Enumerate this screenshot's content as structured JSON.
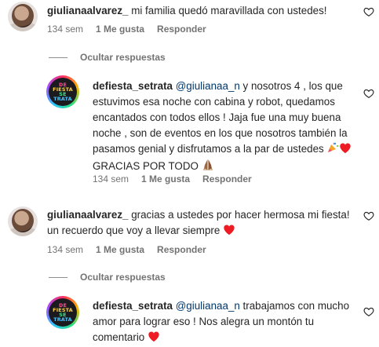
{
  "comments": [
    {
      "username": "giulianaalvarez_",
      "text": " mi familia quedó maravillada con ustedes!",
      "time": "134 sem",
      "likes": "1 Me gusta",
      "reply": "Responder"
    },
    {
      "username": "defiesta_setrata",
      "mention": "@giulianaa_n",
      "text_line1": " y nosotros 4 , los que",
      "text_rest": "estuvimos esa noche con cabina y robot, quedamos encantados con todos ellos ! Jaja fue una muy buena noche , son de eventos en los que nosotros también la pasamos genial y disfrutamos a la par de ustedes ",
      "text_tail": " GRACIAS POR TODO ",
      "time": "134 sem",
      "likes": "1 Me gusta",
      "reply": "Responder"
    },
    {
      "username": "giulianaalvarez_",
      "text": " gracias a ustedes por hacer hermosa mi fiesta! un recuerdo que voy a llevar siempre ",
      "time": "134 sem",
      "likes": "1 Me gusta",
      "reply": "Responder"
    },
    {
      "username": "defiesta_setrata",
      "mention": "@giulianaa_n",
      "text": " trabajamos con mucho amor para lograr eso ! Nos alegra un montón tu comentario ",
      "time": "",
      "likes": "",
      "reply": ""
    }
  ],
  "hide_replies_label": "Ocultar respuestas",
  "logo_text": [
    "DE",
    "FIESTA",
    "SE",
    "TRATA"
  ],
  "colors": {
    "text": "#262626",
    "meta": "#737373",
    "mention": "#00376b",
    "heart_red": "#ed1c24"
  },
  "icons": {
    "like": "heart-outline-icon",
    "red_heart": "red-heart-emoji",
    "party": "party-popper-emoji",
    "hands": "praying-hands-emoji"
  }
}
